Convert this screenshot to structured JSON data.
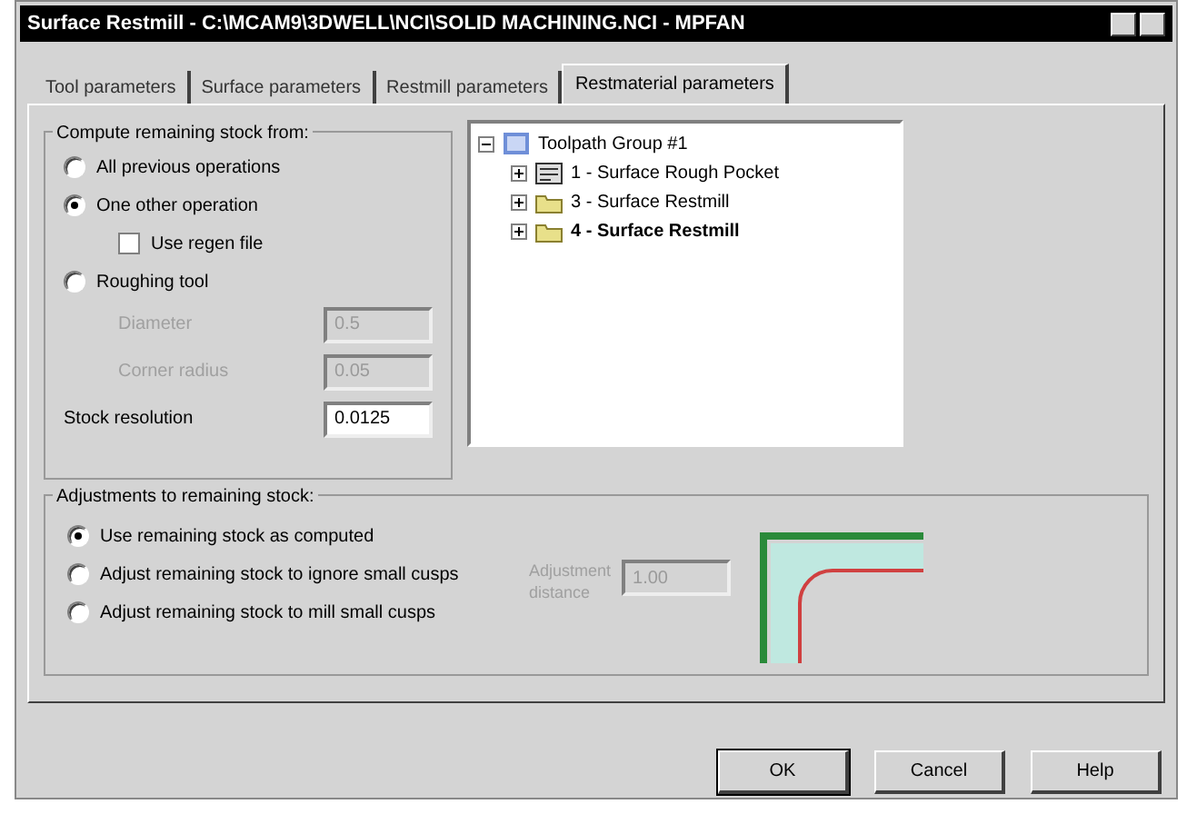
{
  "window": {
    "title": "Surface Restmill - C:\\MCAM9\\3DWELL\\NCI\\SOLID MACHINING.NCI - MPFAN"
  },
  "tabs": [
    {
      "label": "Tool parameters",
      "selected": false
    },
    {
      "label": "Surface parameters",
      "selected": false
    },
    {
      "label": "Restmill parameters",
      "selected": false
    },
    {
      "label": "Restmaterial parameters",
      "selected": true
    }
  ],
  "compute_group": {
    "title": "Compute remaining stock from:",
    "options": [
      {
        "kind": "radio",
        "label": "All previous operations",
        "selected": false
      },
      {
        "kind": "radio",
        "label": "One other operation",
        "selected": true
      },
      {
        "kind": "checkbox",
        "label": "Use regen file",
        "checked": false
      },
      {
        "kind": "radio",
        "label": "Roughing tool",
        "selected": false
      }
    ],
    "fields": [
      {
        "label": "Diameter",
        "value": "0.5",
        "disabled": true
      },
      {
        "label": "Corner radius",
        "value": "0.05",
        "disabled": true
      },
      {
        "label": "Stock resolution",
        "value": "0.0125",
        "disabled": false
      }
    ]
  },
  "tree": {
    "root": {
      "label": "Toolpath Group #1",
      "expanded": true,
      "children": [
        {
          "label": "1 - Surface Rough Pocket",
          "kind": "toolpath",
          "current": false
        },
        {
          "label": "3 - Surface Restmill",
          "kind": "folder",
          "current": false
        },
        {
          "label": "4 - Surface Restmill",
          "kind": "folder",
          "current": true
        }
      ]
    }
  },
  "adjust_group": {
    "title": "Adjustments to remaining stock:",
    "options": [
      {
        "label": "Use remaining stock as computed",
        "selected": true
      },
      {
        "label": "Adjust remaining stock to ignore small cusps",
        "selected": false
      },
      {
        "label": "Adjust remaining stock to mill small cusps",
        "selected": false
      }
    ],
    "distance": {
      "label_lines": [
        "Adjustment",
        "distance"
      ],
      "value": "1.00",
      "disabled": true
    }
  },
  "buttons": [
    {
      "label": "OK",
      "default": true
    },
    {
      "label": "Cancel",
      "default": false
    },
    {
      "label": "Help",
      "default": false
    }
  ]
}
